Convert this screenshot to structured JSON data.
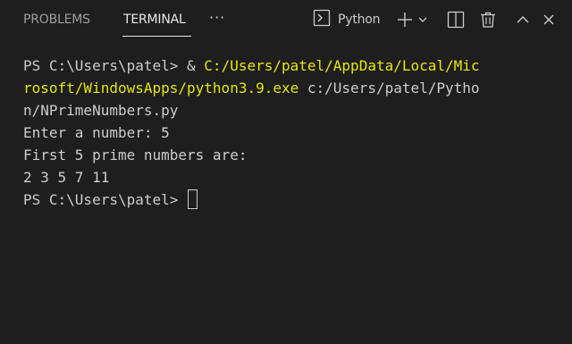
{
  "panel": {
    "tabs": [
      {
        "label": "PROBLEMS"
      },
      {
        "label": "TERMINAL"
      }
    ],
    "more_label": "···",
    "terminal_profile": {
      "label": "Python",
      "icon": "terminal-icon"
    },
    "icons": [
      "terminal-icon",
      "plus-icon",
      "chevron-down-icon",
      "split-icon",
      "trash-icon",
      "chevron-up-icon",
      "close-icon"
    ]
  },
  "terminal": {
    "lines": [
      {
        "prompt": "PS C:\\Users\\patel> & ",
        "highlight": "C:/Users/patel/AppData/Local/Mic",
        "rest": ""
      },
      {
        "prompt": "",
        "highlight": "rosoft/WindowsApps/python3.9.exe",
        "rest": " c:/Users/patel/Pytho"
      },
      {
        "prompt": "",
        "highlight": "",
        "rest": "n/NPrimeNumbers.py"
      },
      {
        "prompt": "",
        "highlight": "",
        "rest": "Enter a number: 5"
      },
      {
        "prompt": "",
        "highlight": "",
        "rest": "First 5 prime numbers are:"
      },
      {
        "prompt": "",
        "highlight": "",
        "rest": "2 3 5 7 11"
      },
      {
        "prompt": "PS C:\\Users\\patel> ",
        "highlight": "",
        "rest": ""
      }
    ]
  },
  "colors": {
    "background": "#1e1e1e",
    "text": "#cccccc",
    "highlight": "#e5e510"
  }
}
